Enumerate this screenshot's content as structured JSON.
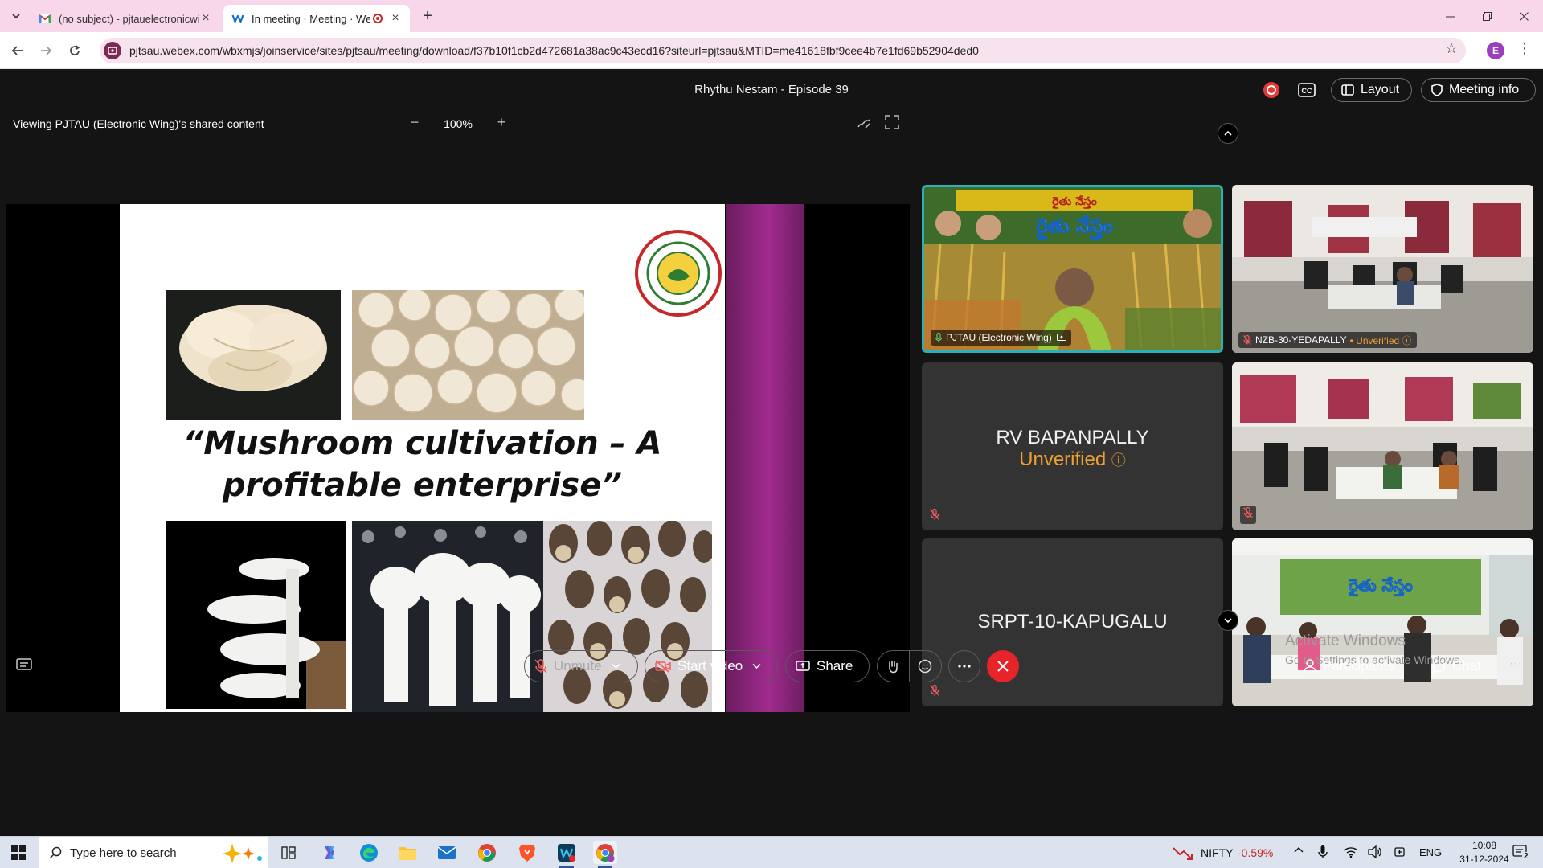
{
  "browser": {
    "tabs": [
      {
        "title": "(no subject) - pjtauelectronicwi",
        "active": false,
        "icon": "gmail-icon"
      },
      {
        "title": "In meeting · Meeting · Webe",
        "active": true,
        "icon": "webex-icon",
        "recording": true
      }
    ],
    "url": "pjtsau.webex.com/wbxmjs/joinservice/sites/pjtsau/meeting/download/f37b10f1cb2d472681a38ac9c43ecd16?siteurl=pjtsau&MTID=me41618fbf9cee4b7e1fd69b52904ded0",
    "profile_initial": "E"
  },
  "meeting": {
    "title": "Rhythu Nestam - Episode 39",
    "layout_label": "Layout",
    "meeting_info_label": "Meeting info",
    "viewing_text": "Viewing PJTAU (Electronic Wing)'s shared content",
    "zoom": "100%",
    "slide": {
      "title_line1": "“Mushroom cultivation – A",
      "title_line2": "profitable enterprise”"
    },
    "participants": [
      {
        "name": "PJTAU (Electronic Wing)",
        "video": true,
        "active_speaker": true
      },
      {
        "name": "NZB-30-YEDAPALLY",
        "video": true,
        "unverified": "Unverified"
      },
      {
        "name": "RV BAPANPALLY",
        "video": false,
        "unverified": "Unverified"
      },
      {
        "name": "",
        "video": true
      },
      {
        "name": "SRPT-10-KAPUGALU",
        "video": false
      },
      {
        "name": "",
        "video": true
      }
    ],
    "controls": {
      "unmute": "Unmute",
      "start_video": "Start video",
      "share": "Share",
      "participants": "Participants",
      "chat": "Chat"
    },
    "watermark": {
      "heading": "Activate Windows",
      "sub": "Go to Settings to activate Windows."
    }
  },
  "taskbar": {
    "search_placeholder": "Type here to search",
    "stock_name": "NIFTY",
    "stock_change": "-0.59%",
    "language": "ENG",
    "time": "10:08",
    "date": "31-12-2024",
    "notification_count": "2"
  },
  "colors": {
    "tab_bar": "#f9d7ea",
    "accent_speaker": "#2bb0b8",
    "unverified": "#f0a030",
    "end_call": "#e5252a",
    "slide_band": "#a02c8e"
  }
}
